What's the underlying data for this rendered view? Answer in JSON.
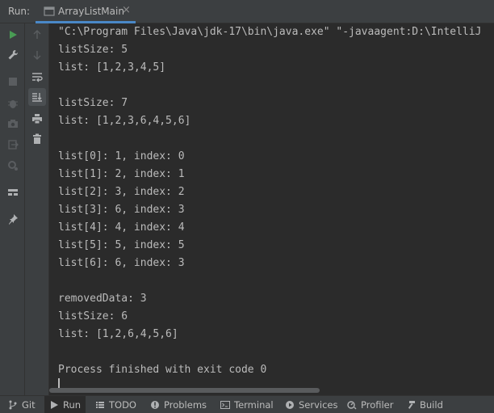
{
  "run_panel": {
    "label": "Run:",
    "tab": {
      "title": "ArrayListMain",
      "close_glyph": "×"
    }
  },
  "console": {
    "lines": [
      "\"C:\\Program Files\\Java\\jdk-17\\bin\\java.exe\" \"-javaagent:D:\\IntelliJ",
      "listSize: 5",
      "list: [1,2,3,4,5]",
      "",
      "listSize: 7",
      "list: [1,2,3,6,4,5,6]",
      "",
      "list[0]: 1, index: 0",
      "list[1]: 2, index: 1",
      "list[2]: 3, index: 2",
      "list[3]: 6, index: 3",
      "list[4]: 4, index: 4",
      "list[5]: 5, index: 5",
      "list[6]: 6, index: 3",
      "",
      "removedData: 3",
      "listSize: 6",
      "list: [1,2,6,4,5,6]",
      "",
      "Process finished with exit code 0"
    ]
  },
  "bottom_bar": {
    "git": "Git",
    "run": "Run",
    "todo": "TODO",
    "problems": "Problems",
    "terminal": "Terminal",
    "services": "Services",
    "profiler": "Profiler",
    "build": "Build"
  },
  "colors": {
    "accent": "#4a88c7",
    "run_green": "#499c54",
    "panel_bg": "#3c3f41",
    "console_bg": "#2b2b2b",
    "text": "#bbbbbb"
  }
}
